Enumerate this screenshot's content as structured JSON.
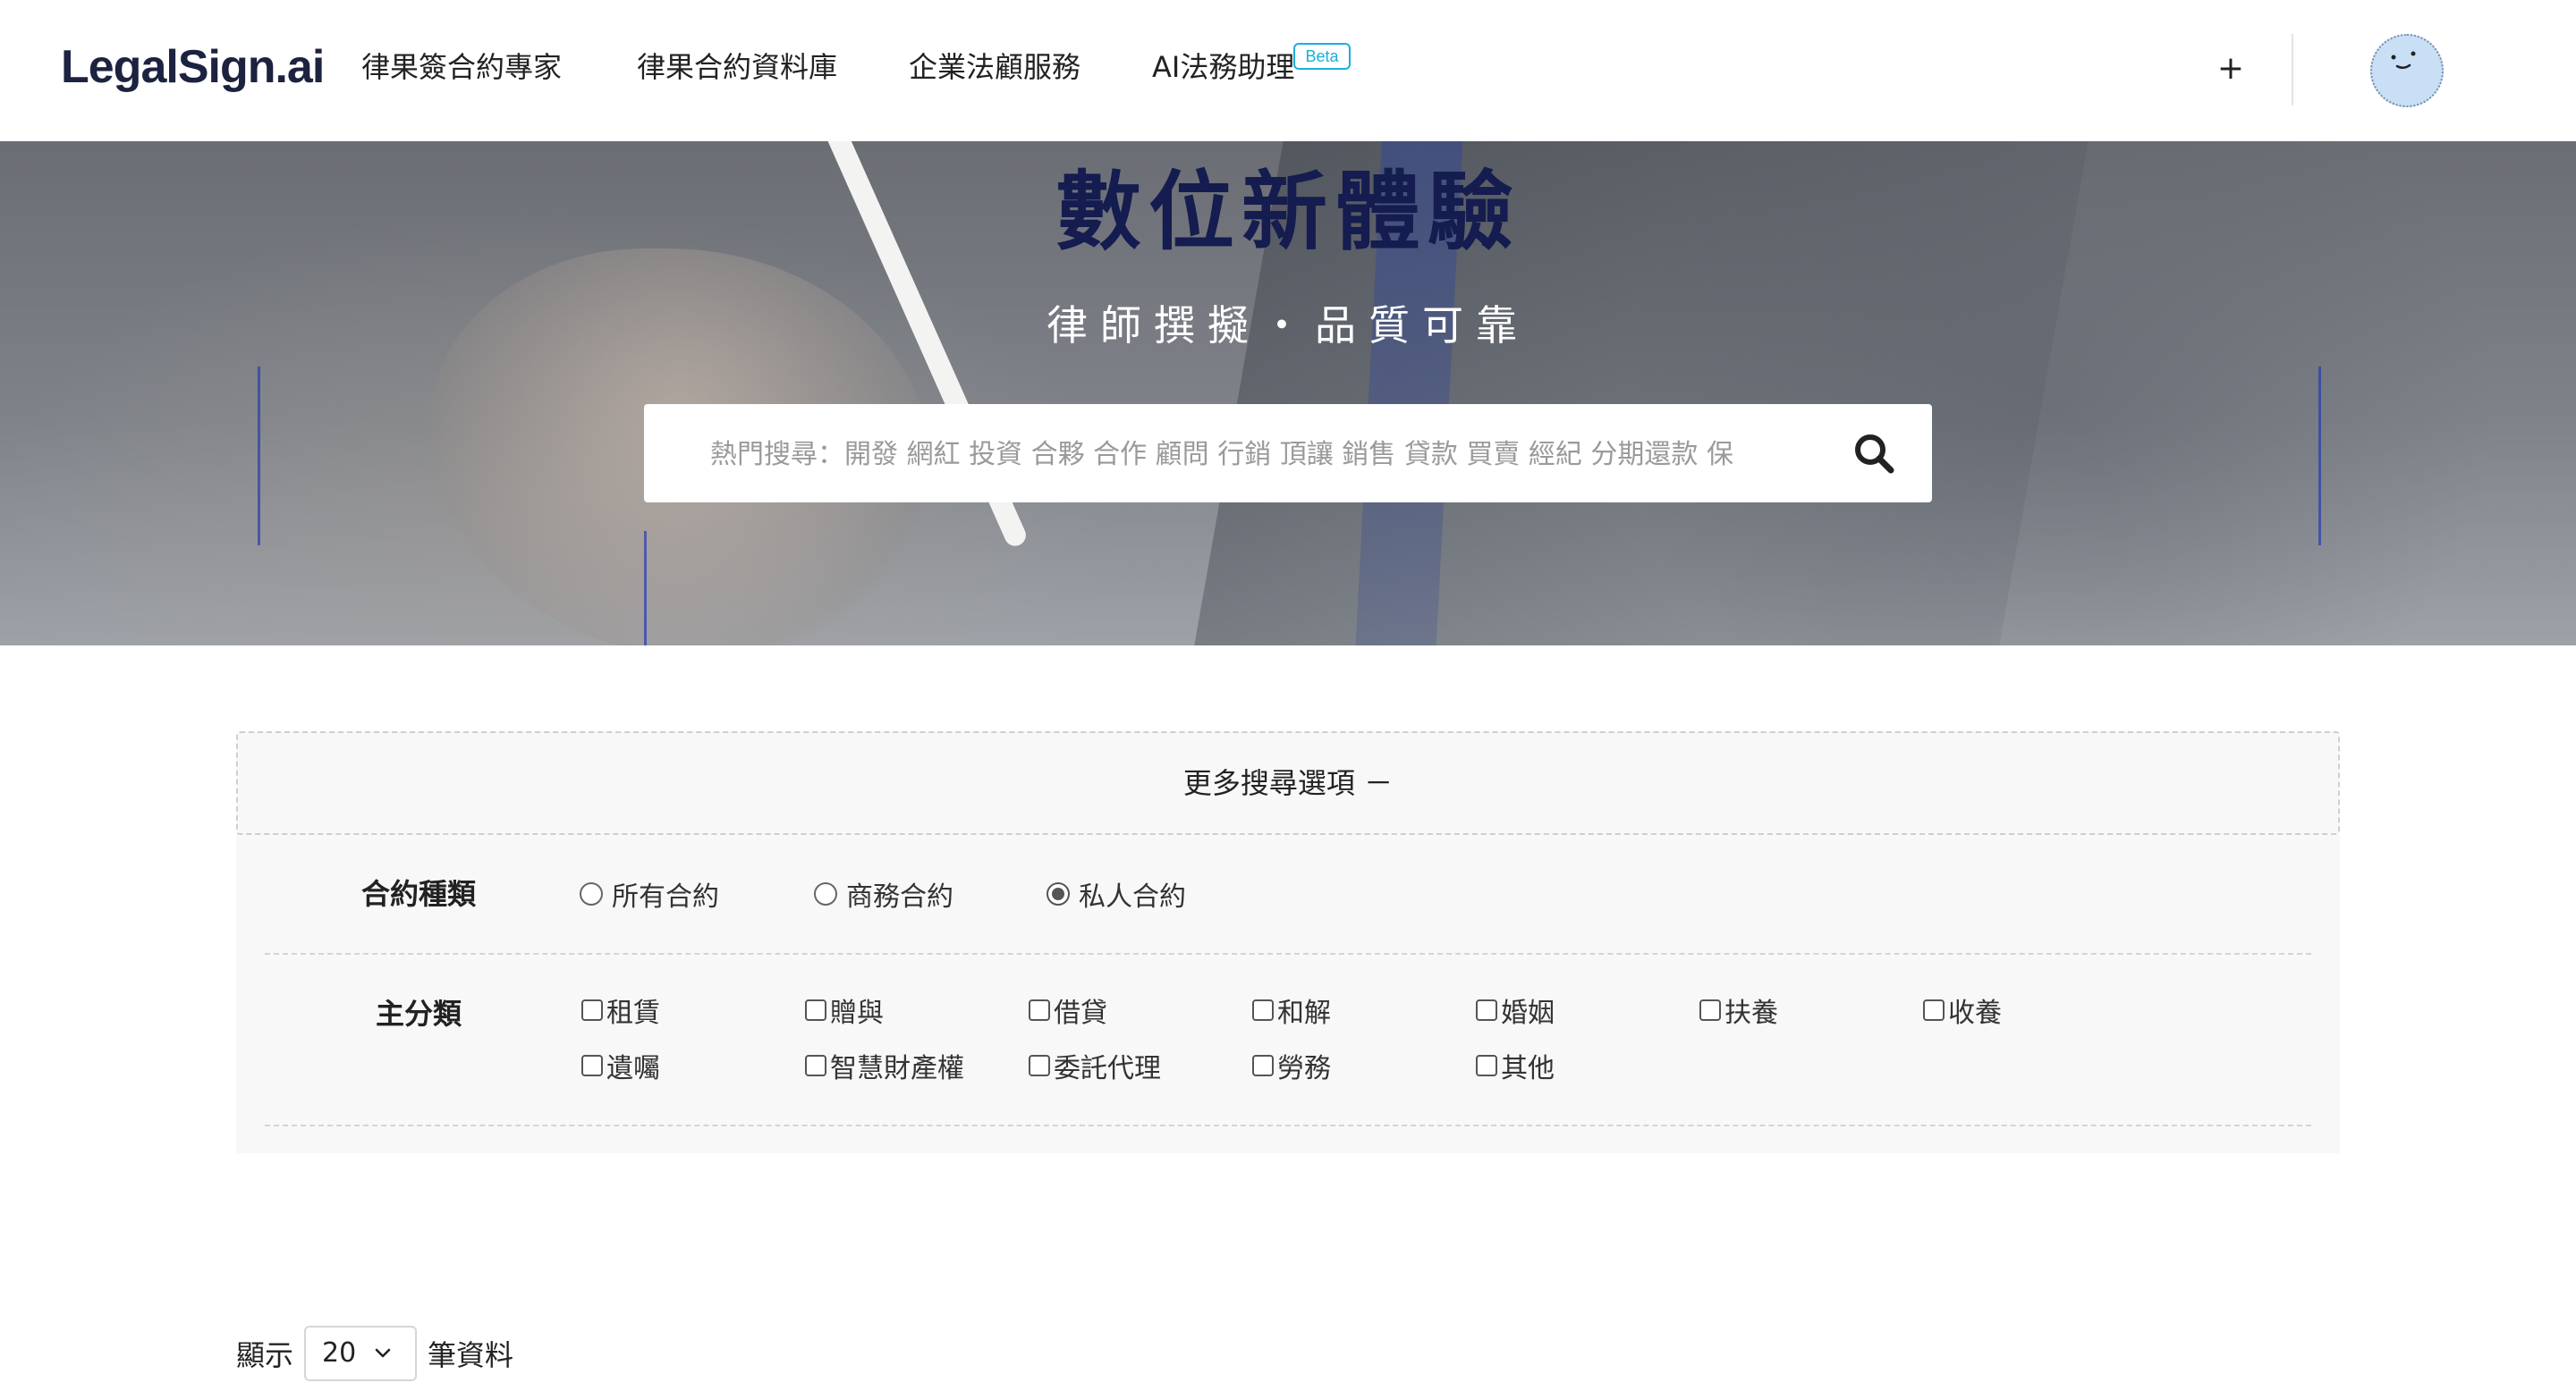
{
  "header": {
    "logo": "LegalSign.ai",
    "nav": [
      {
        "label": "律果簽合約專家"
      },
      {
        "label": "律果合約資料庫"
      },
      {
        "label": "企業法顧服務"
      },
      {
        "label": "AI法務助理"
      }
    ],
    "beta_badge": "Beta",
    "plus_label": "+"
  },
  "hero": {
    "title": "數位新體驗",
    "subtitle": "律師撰擬・品質可靠",
    "search": {
      "placeholder": "熱門搜尋：開發 網紅 投資 合夥 合作 顧問 行銷 頂讓 銷售 貸款 買賣 經紀 分期還款 保",
      "icon": "search-icon"
    }
  },
  "filters": {
    "more_options_label": "更多搜尋選項 －",
    "contract_type": {
      "label": "合約種類",
      "options": [
        "所有合約",
        "商務合約",
        "私人合約"
      ],
      "selected": "私人合約"
    },
    "main_category": {
      "label": "主分類",
      "options": [
        "租賃",
        "贈與",
        "借貸",
        "和解",
        "婚姻",
        "扶養",
        "收養",
        "遺囑",
        "智慧財產權",
        "委託代理",
        "勞務",
        "其他"
      ]
    }
  },
  "pagination": {
    "show_label": "顯示",
    "page_size": "20",
    "suffix_label": "筆資料"
  },
  "colors": {
    "brand_dark": "#141c50",
    "beta_accent": "#19b0d8",
    "panel_bg": "#f8f8f8"
  }
}
